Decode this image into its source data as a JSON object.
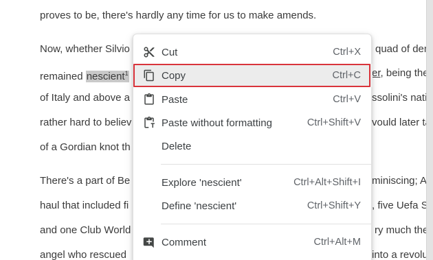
{
  "document": {
    "lines": {
      "l1": "proves to be, there's hardly any time for us to make amends.",
      "l2_left": "Now, whether Silvio",
      "l2_right": "quad of demi",
      "l3_left": "remained ",
      "l3_selected": "nescient",
      "l3_sup": "1",
      "l3_right_a": "er",
      "l3_right_b": ", being the p",
      "l4_left": "of Italy and above a",
      "l4_right": "ssolini's natio",
      "l5_left": "rather hard to believ",
      "l5_right": "vould later tal",
      "l6_left": "of a Gordian knot th",
      "l7_left": "There's a part of Be",
      "l7_right": "miniscing; A",
      "l8_left": "haul that included fi",
      "l8_right": ", five Uefa S",
      "l9_left": "and one Club World",
      "l9_right": "ry much the",
      "l10_left": "angel who rescued",
      "l10_right": "into a revolut"
    }
  },
  "context_menu": {
    "items": [
      {
        "label": "Cut",
        "shortcut": "Ctrl+X",
        "icon": "scissors-icon"
      },
      {
        "label": "Copy",
        "shortcut": "Ctrl+C",
        "icon": "copy-icon"
      },
      {
        "label": "Paste",
        "shortcut": "Ctrl+V",
        "icon": "clipboard-icon"
      },
      {
        "label": "Paste without formatting",
        "shortcut": "Ctrl+Shift+V",
        "icon": "clipboard-text-icon"
      },
      {
        "label": "Delete",
        "shortcut": "",
        "icon": ""
      },
      {
        "label": "Explore 'nescient'",
        "shortcut": "Ctrl+Alt+Shift+I",
        "icon": ""
      },
      {
        "label": "Define 'nescient'",
        "shortcut": "Ctrl+Shift+Y",
        "icon": ""
      },
      {
        "label": "Comment",
        "shortcut": "Ctrl+Alt+M",
        "icon": "add-comment-icon"
      }
    ],
    "highlighted_item": "Copy"
  },
  "colors": {
    "highlight_outline": "#d9333b",
    "selection": "#c9c9c9",
    "menu_hover": "#ececec"
  }
}
